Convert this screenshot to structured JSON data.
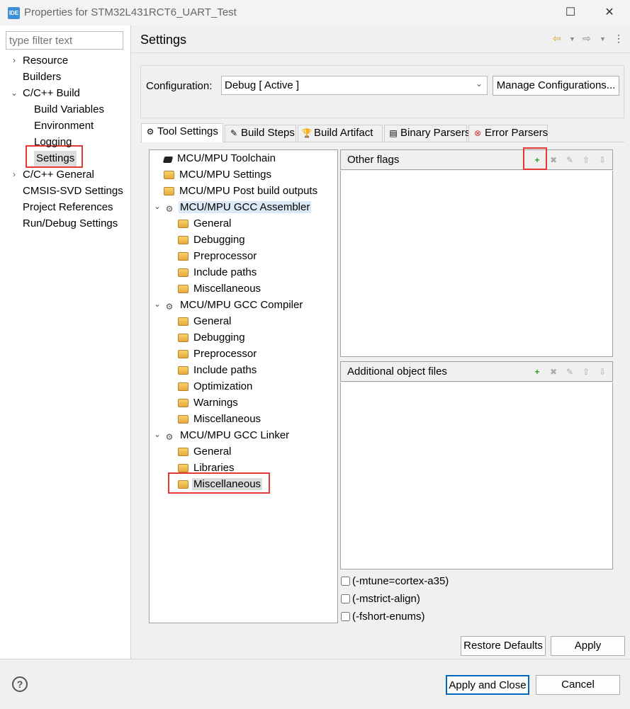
{
  "window": {
    "logo": "IDE",
    "title": "Properties for STM32L431RCT6_UART_Test",
    "minimize": "—",
    "maximize": "☐",
    "close": "✕"
  },
  "filter": {
    "placeholder": "type filter text"
  },
  "nav": [
    {
      "label": "Resource",
      "level": 0,
      "chevron": "›"
    },
    {
      "label": "Builders",
      "level": 0
    },
    {
      "label": "C/C++ Build",
      "level": 0,
      "chevron": "⌄"
    },
    {
      "label": "Build Variables",
      "level": 1
    },
    {
      "label": "Environment",
      "level": 1
    },
    {
      "label": "Logging",
      "level": 1
    },
    {
      "label": "Settings",
      "level": 1,
      "selected": true
    },
    {
      "label": "C/C++ General",
      "level": 0,
      "chevron": "›"
    },
    {
      "label": "CMSIS-SVD Settings",
      "level": 0
    },
    {
      "label": "Project References",
      "level": 0
    },
    {
      "label": "Run/Debug Settings",
      "level": 0
    }
  ],
  "page": {
    "title": "Settings",
    "back_icon": "⇦",
    "forward_icon": "⇨",
    "menu_icon": "⋮"
  },
  "configuration": {
    "label": "Configuration:",
    "value": "Debug  [ Active ]",
    "manage_label": "Manage Configurations..."
  },
  "tabs": [
    {
      "label": "Tool Settings",
      "icon": "⚙",
      "active": true
    },
    {
      "label": "Build Steps",
      "icon": "✎"
    },
    {
      "label": "Build Artifact",
      "icon": "🏆"
    },
    {
      "label": "Binary Parsers",
      "icon": "▤"
    },
    {
      "label": "Error Parsers",
      "icon": "⊗"
    }
  ],
  "tree": [
    {
      "label": "MCU/MPU Toolchain",
      "level": 0,
      "icon": "chip"
    },
    {
      "label": "MCU/MPU Settings",
      "level": 0,
      "icon": "folder"
    },
    {
      "label": "MCU/MPU Post build outputs",
      "level": 0,
      "icon": "folder"
    },
    {
      "label": "MCU/MPU GCC Assembler",
      "level": 0,
      "icon": "gear",
      "chevron": "⌄",
      "highlight": true
    },
    {
      "label": "General",
      "level": 1,
      "icon": "folder"
    },
    {
      "label": "Debugging",
      "level": 1,
      "icon": "folder"
    },
    {
      "label": "Preprocessor",
      "level": 1,
      "icon": "folder"
    },
    {
      "label": "Include paths",
      "level": 1,
      "icon": "folder"
    },
    {
      "label": "Miscellaneous",
      "level": 1,
      "icon": "folder"
    },
    {
      "label": "MCU/MPU GCC Compiler",
      "level": 0,
      "icon": "gear",
      "chevron": "⌄"
    },
    {
      "label": "General",
      "level": 1,
      "icon": "folder"
    },
    {
      "label": "Debugging",
      "level": 1,
      "icon": "folder"
    },
    {
      "label": "Preprocessor",
      "level": 1,
      "icon": "folder"
    },
    {
      "label": "Include paths",
      "level": 1,
      "icon": "folder"
    },
    {
      "label": "Optimization",
      "level": 1,
      "icon": "folder"
    },
    {
      "label": "Warnings",
      "level": 1,
      "icon": "folder"
    },
    {
      "label": "Miscellaneous",
      "level": 1,
      "icon": "folder"
    },
    {
      "label": "MCU/MPU GCC Linker",
      "level": 0,
      "icon": "gear",
      "chevron": "⌄"
    },
    {
      "label": "General",
      "level": 1,
      "icon": "folder"
    },
    {
      "label": "Libraries",
      "level": 1,
      "icon": "folder"
    },
    {
      "label": "Miscellaneous",
      "level": 1,
      "icon": "folder",
      "selected": true
    }
  ],
  "lists": [
    {
      "title": "Other flags"
    },
    {
      "title": "Additional object files"
    }
  ],
  "list_buttons": [
    {
      "name": "add",
      "glyph": "+",
      "enabled": true
    },
    {
      "name": "delete",
      "glyph": "✖"
    },
    {
      "name": "edit",
      "glyph": "✎"
    },
    {
      "name": "move-up",
      "glyph": "⇧"
    },
    {
      "name": "move-down",
      "glyph": "⇩"
    }
  ],
  "options": [
    {
      "label": "(-mtune=cortex-a35)",
      "checked": false
    },
    {
      "label": "(-mstrict-align)",
      "checked": false
    },
    {
      "label": "(-fshort-enums)",
      "checked": false
    }
  ],
  "buttons": {
    "restore": "Restore Defaults",
    "apply": "Apply",
    "apply_close": "Apply and Close",
    "cancel": "Cancel",
    "help": "?"
  },
  "colors": {
    "highlight_box": "#e53935",
    "selection": "#dcdcdc",
    "tree_highlight": "#dbe9f7"
  }
}
